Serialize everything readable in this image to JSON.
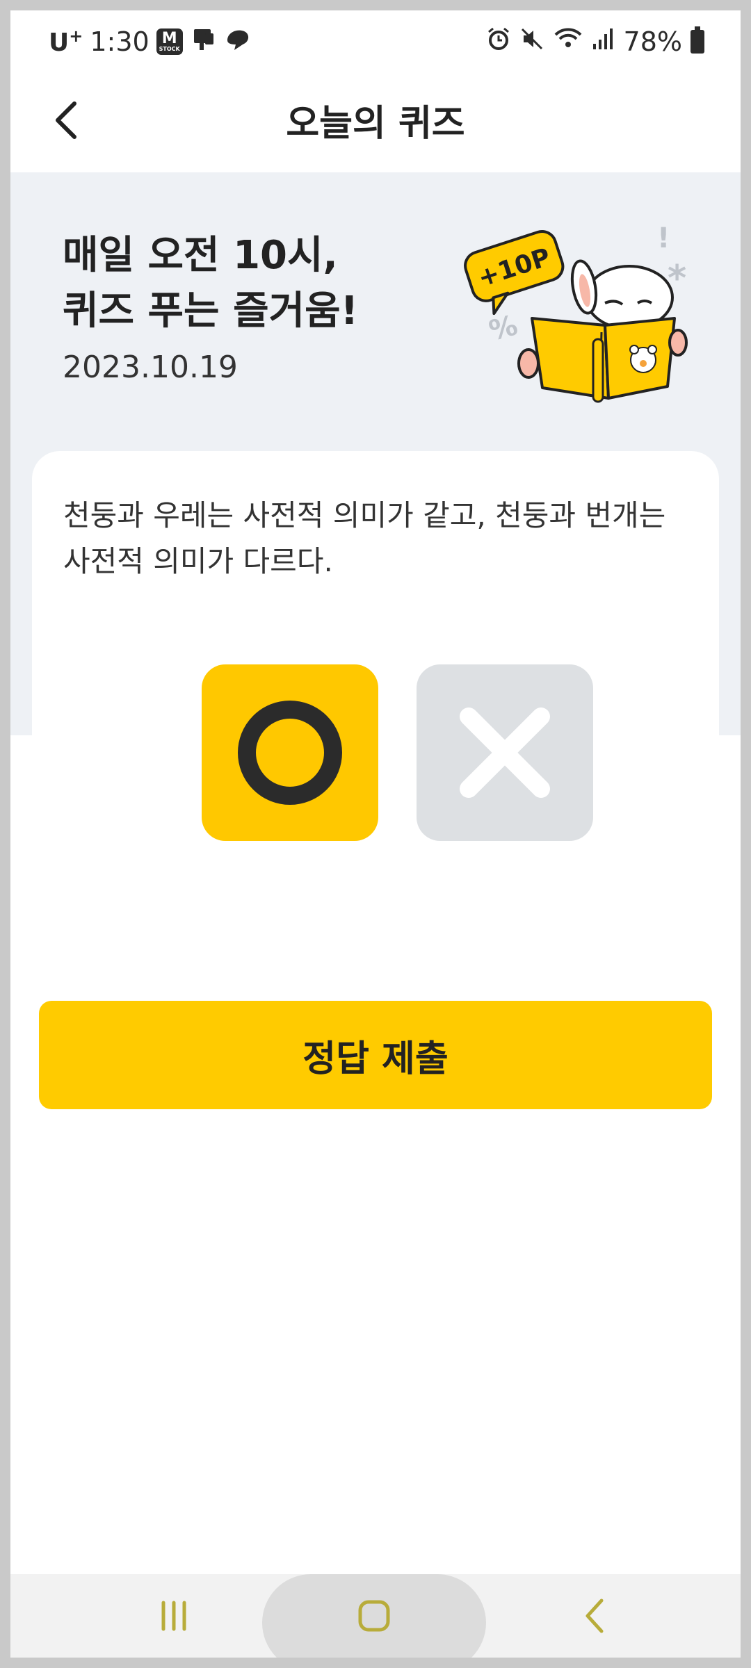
{
  "status_bar": {
    "carrier": "U",
    "carrier_sup": "+",
    "time": "1:30",
    "app_icon_label": "M",
    "app_icon_sub": "STOCK",
    "battery": "78%",
    "icons": [
      "alarm-icon",
      "mute-icon",
      "wifi-icon",
      "signal-icon",
      "battery-icon"
    ]
  },
  "header": {
    "title": "오늘의 퀴즈"
  },
  "banner": {
    "line1": "매일 오전 10시,",
    "line2": "퀴즈 푸는 즐거움!",
    "date": "2023.10.19",
    "badge": "+10P"
  },
  "quiz": {
    "question": "천둥과 우레는 사전적 의미가 같고, 천둥과 번개는 사전적 의미가 다르다.",
    "option_o": "O",
    "option_x": "X",
    "selected": "O"
  },
  "submit_label": "정답 제출",
  "colors": {
    "accent": "#ffcb00",
    "banner_bg": "#eef1f5",
    "option_off": "#dde0e3"
  }
}
